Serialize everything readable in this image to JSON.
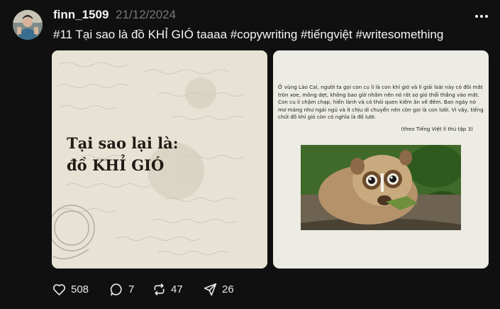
{
  "post": {
    "username": "finn_1509",
    "date": "21/12/2024",
    "caption": "#11 Tại sao là đồ KHỈ GIÓ taaaa #copywriting #tiếngviệt #writesomething",
    "more_icon": "more-icon"
  },
  "slides": [
    {
      "title_line1": "Tại sao lại là:",
      "title_line2": "đồ KHỈ GIÓ"
    },
    {
      "story": "Ở vùng Lào Cai, người ta gọi con cu li là con khỉ gió và lí giải loài này có đôi mắt tròn xoe, mông dẹt, không bao giờ nhắm nên nó rất sợ gió thổi thẳng vào mắt. Con cu li chậm chạp, hiền lành và có thói quen kiếm ăn về đêm. Ban ngày nó mơ màng như ngái ngủ và ít chịu di chuyển nên còn gọi là con lười. Vì vậy, tiếng chửi đồ khỉ gió còn có nghĩa là đồ lười.",
      "source": "(theo Tiếng Việt lí thú tập 3)",
      "photo_icon": "slow-loris-photo"
    }
  ],
  "actions": {
    "likes": "508",
    "comments": "7",
    "reposts": "47",
    "shares": "26"
  }
}
